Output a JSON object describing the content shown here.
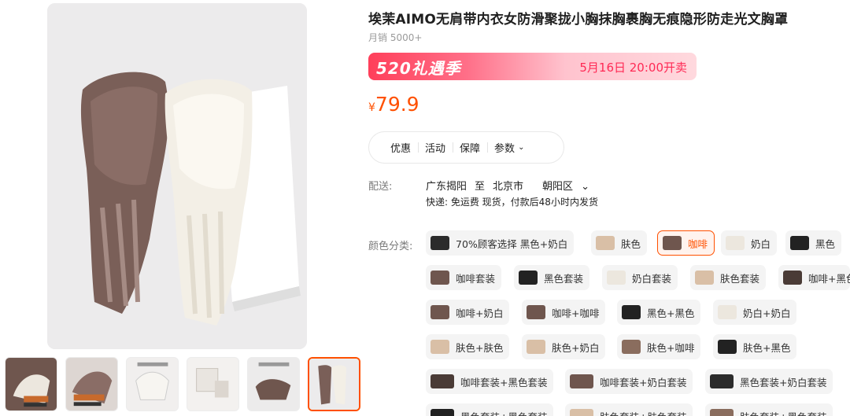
{
  "product": {
    "title": "埃茉AIMO无肩带内衣女防滑聚拢小胸抹胸裹胸无痕隐形防走光文胸罩",
    "sales": "月销 5000+"
  },
  "promo": {
    "name": "520礼遇季",
    "time": "5月16日 20:00开卖"
  },
  "price": {
    "currency": "¥",
    "value": "79.9"
  },
  "tabs": [
    {
      "label": "优惠"
    },
    {
      "label": "活动"
    },
    {
      "label": "保障"
    },
    {
      "label": "参数"
    }
  ],
  "shipping": {
    "label": "配送:",
    "from": "广东揭阳",
    "to_word": "至",
    "city": "北京市",
    "district": "朝阳区",
    "detail": "快递: 免运费  现货，付款后48小时内发货"
  },
  "colors": {
    "label": "颜色分类:",
    "selected": "咖啡",
    "options": [
      {
        "label": "70%顾客选择 黑色+奶白",
        "swatch": "#2b2b2b"
      },
      {
        "label": "肤色",
        "swatch": "#d9bfa6"
      },
      {
        "label": "咖啡",
        "swatch": "#6f564e"
      },
      {
        "label": "奶白",
        "swatch": "#ece7de"
      },
      {
        "label": "黑色",
        "swatch": "#222222"
      },
      {
        "label": "咖啡套装",
        "swatch": "#6f564e"
      },
      {
        "label": "黑色套装",
        "swatch": "#222222"
      },
      {
        "label": "奶白套装",
        "swatch": "#ece7de"
      },
      {
        "label": "肤色套装",
        "swatch": "#d9bfa6"
      },
      {
        "label": "咖啡+黑色",
        "swatch": "#4a3b36"
      },
      {
        "label": "咖啡+奶白",
        "swatch": "#6f564e"
      },
      {
        "label": "咖啡+咖啡",
        "swatch": "#6f564e"
      },
      {
        "label": "黑色+黑色",
        "swatch": "#222222"
      },
      {
        "label": "奶白+奶白",
        "swatch": "#ece7de"
      },
      {
        "label": "肤色+肤色",
        "swatch": "#d9bfa6"
      },
      {
        "label": "肤色+奶白",
        "swatch": "#d9bfa6"
      },
      {
        "label": "肤色+咖啡",
        "swatch": "#8a6d5e"
      },
      {
        "label": "肤色+黑色",
        "swatch": "#222222"
      },
      {
        "label": "咖啡套装+黑色套装",
        "swatch": "#4a3b36"
      },
      {
        "label": "咖啡套装+奶白套装",
        "swatch": "#6f564e"
      },
      {
        "label": "黑色套装+奶白套装",
        "swatch": "#2b2b2b"
      },
      {
        "label": "黑色套装+黑色套装",
        "swatch": "#222222"
      },
      {
        "label": "肤色套装+肤色套装",
        "swatch": "#d9bfa6"
      },
      {
        "label": "肤色套装+黑色套装",
        "swatch": "#8a6d5e"
      }
    ]
  },
  "thumbnails": [
    {
      "caption": "前不掉 后防滑"
    },
    {
      "caption": "前不掉 后防滑"
    },
    {
      "caption": ""
    },
    {
      "caption": ""
    },
    {
      "caption": ""
    },
    {
      "caption": ""
    }
  ]
}
